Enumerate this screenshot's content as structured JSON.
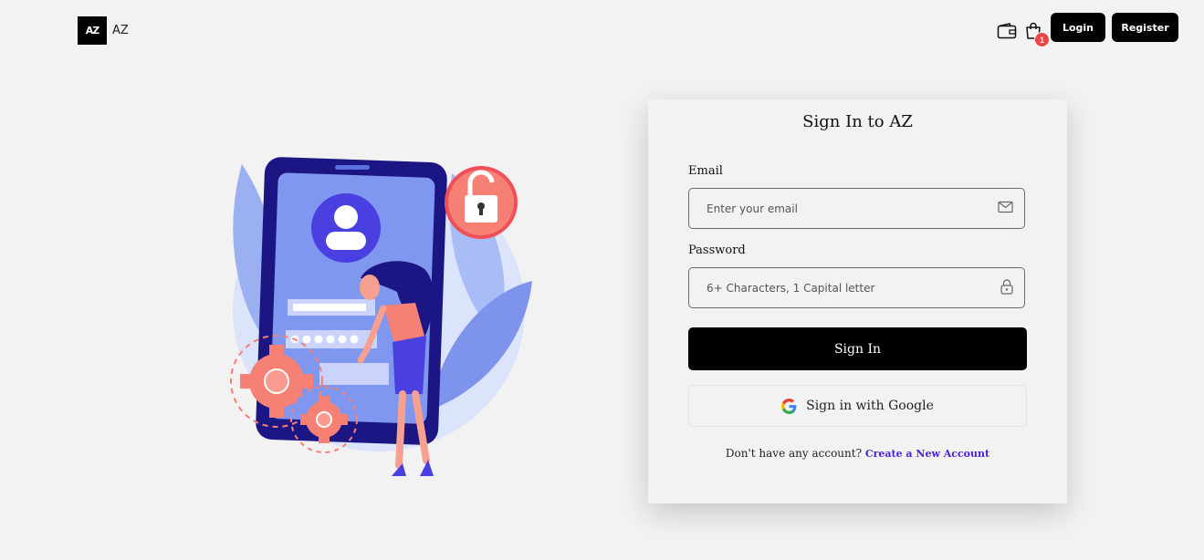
{
  "header": {
    "logo_text": "AZ",
    "brand_name": "AZ",
    "cart_count": "1",
    "login_label": "Login",
    "register_label": "Register"
  },
  "signin": {
    "title": "Sign In to AZ",
    "email_label": "Email",
    "email_placeholder": "Enter your email",
    "password_label": "Password",
    "password_placeholder": "6+ Characters, 1 Capital letter",
    "submit_label": "Sign In",
    "google_label": "Sign in with Google",
    "no_account_text": "Don't have any account?",
    "create_account_label": "Create a New Account"
  },
  "colors": {
    "primary": "#000000",
    "background": "#f2f2f2",
    "link": "#4b1fd6",
    "badge": "#ef4444"
  }
}
